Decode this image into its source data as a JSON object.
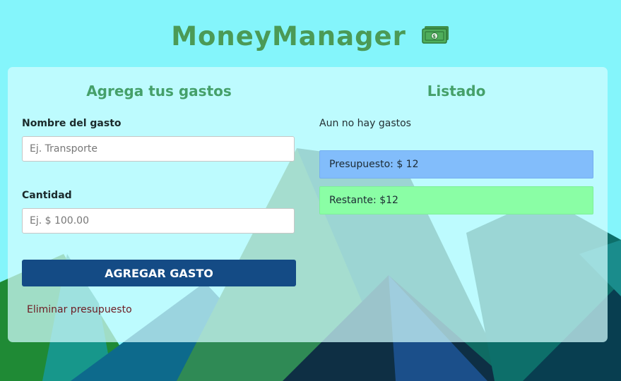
{
  "app": {
    "title": "MoneyManager",
    "title_icon": "money-bill-icon",
    "colors": {
      "background": "#84f5fb",
      "title": "#4b9a56",
      "heading": "#45a06a",
      "primary_button": "#144b85",
      "budget_alert": "#82bdfb",
      "remaining_alert": "#8afea5",
      "delete_link": "#6d1b22"
    }
  },
  "form": {
    "heading": "Agrega tus gastos",
    "name_label": "Nombre del gasto",
    "name_placeholder": "Ej. Transporte",
    "amount_label": "Cantidad",
    "amount_placeholder": "Ej. $ 100.00",
    "submit_label": "AGREGAR GASTO",
    "delete_budget_label": "Eliminar presupuesto"
  },
  "listing": {
    "heading": "Listado",
    "empty_message": "Aun no hay gastos",
    "budget_text": "Presupuesto: $ 12",
    "remaining_text": "Restante: $12"
  }
}
